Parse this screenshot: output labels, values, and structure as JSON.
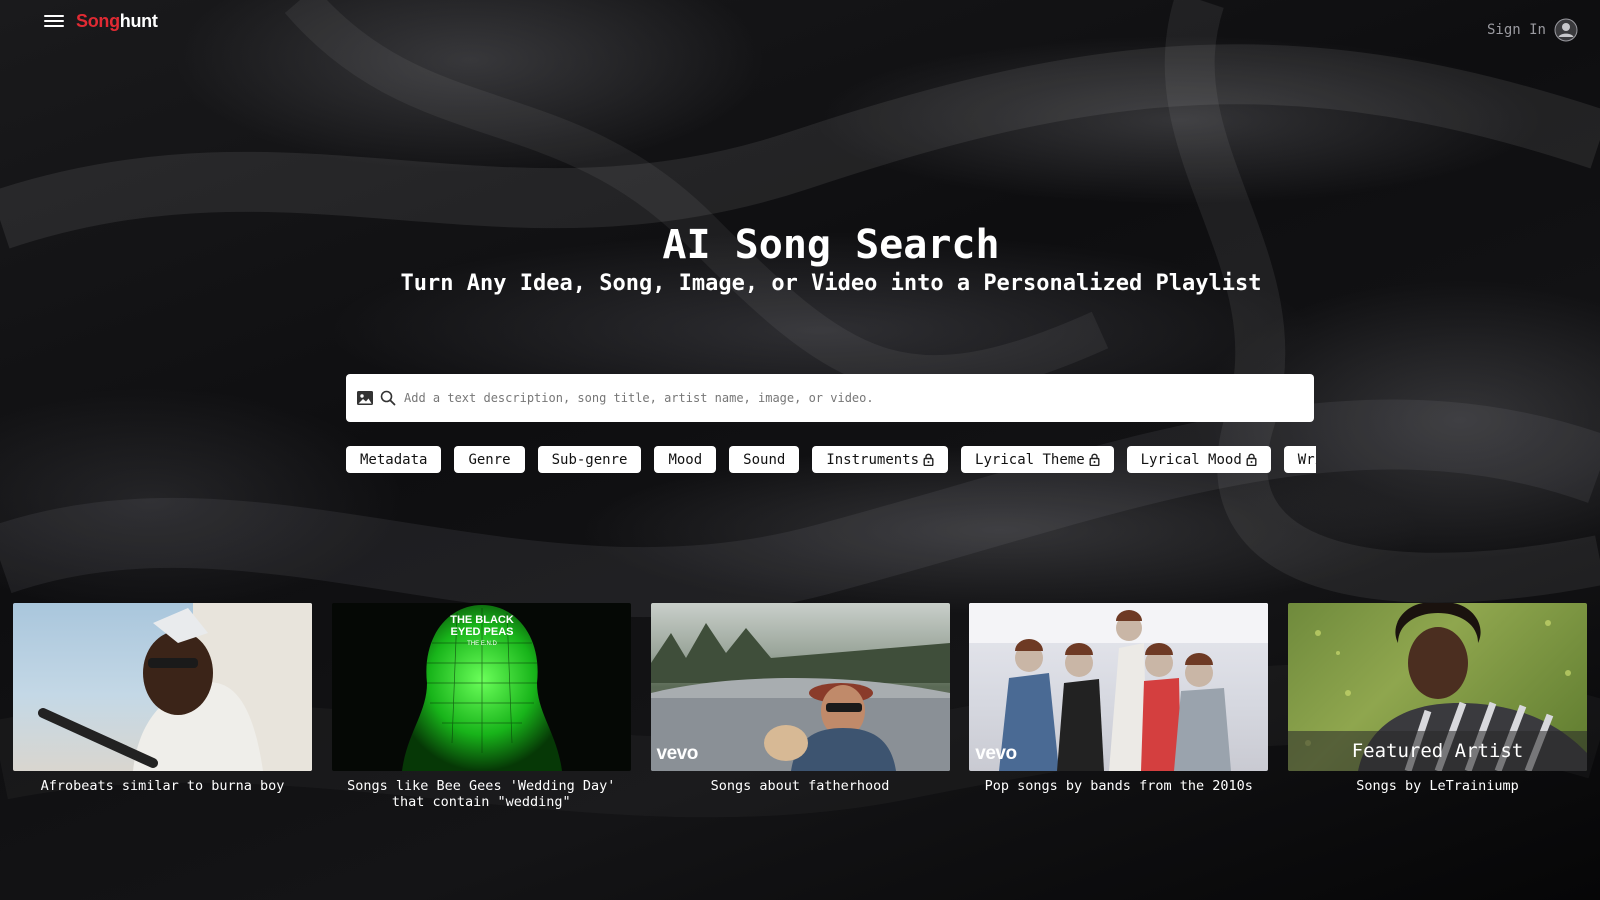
{
  "header": {
    "logo": {
      "part1": "Song",
      "part2": "hunt",
      "accent_color": "#e02a33"
    },
    "menu_icon": "hamburger-icon",
    "signin_label": "Sign In",
    "signin_icon": "user-avatar-icon"
  },
  "hero": {
    "title": "AI Song Search",
    "subtitle": "Turn Any Idea, Song, Image, or Video into a Personalized Playlist"
  },
  "search": {
    "placeholder": "Add a text description, song title, artist name, image, or video.",
    "value": "",
    "image_icon": "image-icon",
    "search_icon": "search-icon"
  },
  "chips": [
    {
      "label": "Metadata",
      "locked": false
    },
    {
      "label": "Genre",
      "locked": false
    },
    {
      "label": "Sub-genre",
      "locked": false
    },
    {
      "label": "Mood",
      "locked": false
    },
    {
      "label": "Sound",
      "locked": false
    },
    {
      "label": "Instruments",
      "locked": true
    },
    {
      "label": "Lyrical Theme",
      "locked": true
    },
    {
      "label": "Lyrical Mood",
      "locked": true
    },
    {
      "label": "Writi",
      "locked": false
    }
  ],
  "cards": [
    {
      "caption": "Afrobeats similar to burna boy"
    },
    {
      "caption": "Songs like Bee Gees 'Wedding Day' that contain \"wedding\"",
      "album_text": {
        "line1": "THE BLACK",
        "line2": "EYED PEAS",
        "line3": "THE E.N.D"
      }
    },
    {
      "caption": "Songs about fatherhood",
      "badge": "vevo"
    },
    {
      "caption": "Pop songs by bands from the 2010s",
      "badge": "vevo"
    },
    {
      "caption": "Songs by LeTrainiump",
      "overlay": "Featured Artist"
    }
  ]
}
